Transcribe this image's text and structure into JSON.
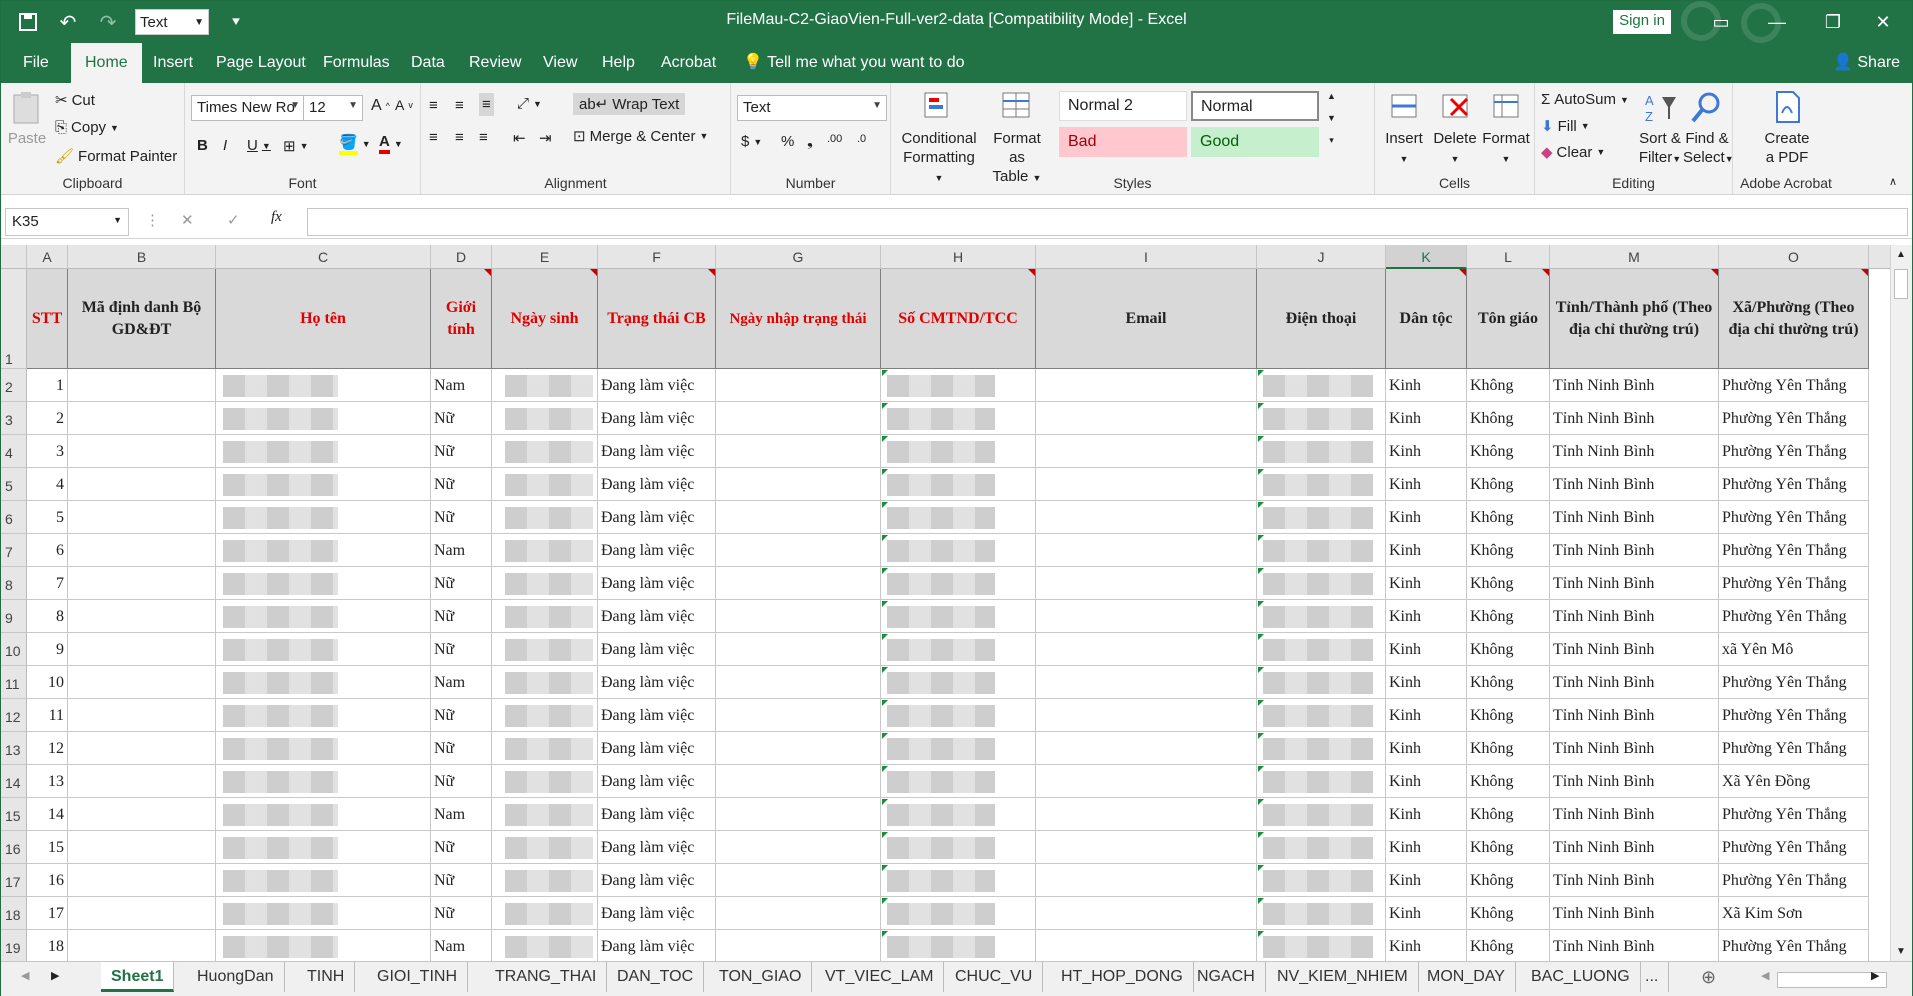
{
  "window": {
    "title": "FileMau-C2-GiaoVien-Full-ver2-data  [Compatibility Mode]  -  Excel",
    "signin": "Sign in",
    "qat_format": "Text"
  },
  "ribbon_tabs": [
    "File",
    "Home",
    "Insert",
    "Page Layout",
    "Formulas",
    "Data",
    "Review",
    "View",
    "Help",
    "Acrobat"
  ],
  "tellme": "Tell me what you want to do",
  "share": "Share",
  "clipboard": {
    "paste": "Paste",
    "cut": "Cut",
    "copy": "Copy",
    "format_painter": "Format Painter",
    "label": "Clipboard"
  },
  "font": {
    "name": "Times New Ro",
    "size": "12",
    "label": "Font"
  },
  "alignment": {
    "wrap": "Wrap Text",
    "merge": "Merge & Center",
    "label": "Alignment"
  },
  "number": {
    "format": "Text",
    "label": "Number"
  },
  "styles": {
    "cond1": "Conditional",
    "cond2": "Formatting",
    "fmt1": "Format as",
    "fmt2": "Table",
    "normal2": "Normal 2",
    "normal": "Normal",
    "bad": "Bad",
    "good": "Good",
    "label": "Styles"
  },
  "cells": {
    "insert": "Insert",
    "delete": "Delete",
    "format": "Format",
    "label": "Cells"
  },
  "editing": {
    "autosum": "AutoSum",
    "fill": "Fill",
    "clear": "Clear",
    "sort1": "Sort &",
    "sort2": "Filter",
    "find1": "Find &",
    "find2": "Select",
    "label": "Editing"
  },
  "acrobat": {
    "create1": "Create",
    "create2": "a PDF",
    "label": "Adobe Acrobat"
  },
  "namebox": "K35",
  "columns": [
    "A",
    "B",
    "C",
    "D",
    "E",
    "F",
    "G",
    "H",
    "I",
    "J",
    "K",
    "L",
    "M",
    "O"
  ],
  "headers": {
    "A": "STT",
    "B": "Mã định danh Bộ GD&ĐT",
    "C": "Họ tên",
    "D": "Giới tính",
    "E": "Ngày sinh",
    "F": "Trạng thái CB",
    "G": "Ngày nhập trạng thái",
    "H": "Số CMTND/TCC",
    "I": "Email",
    "J": "Điện thoại",
    "K": "Dân tộc",
    "L": "Tôn giáo",
    "M": "Tỉnh/Thành phố (Theo địa chỉ thường trú)",
    "O": "Xã/Phường (Theo địa chỉ thường trú)"
  },
  "rows": [
    {
      "stt": "1",
      "gender": "Nam",
      "status": "Đang làm việc",
      "ethnic": "Kinh",
      "religion": "Không",
      "province": "Tỉnh Ninh Bình",
      "commune": "Phường Yên Thắng"
    },
    {
      "stt": "2",
      "gender": "Nữ",
      "status": "Đang làm việc",
      "ethnic": "Kinh",
      "religion": "Không",
      "province": "Tỉnh Ninh Bình",
      "commune": "Phường Yên Thắng"
    },
    {
      "stt": "3",
      "gender": "Nữ",
      "status": "Đang làm việc",
      "ethnic": "Kinh",
      "religion": "Không",
      "province": "Tỉnh Ninh Bình",
      "commune": "Phường Yên Thắng"
    },
    {
      "stt": "4",
      "gender": "Nữ",
      "status": "Đang làm việc",
      "ethnic": "Kinh",
      "religion": "Không",
      "province": "Tỉnh Ninh Bình",
      "commune": "Phường Yên Thắng"
    },
    {
      "stt": "5",
      "gender": "Nữ",
      "status": "Đang làm việc",
      "ethnic": "Kinh",
      "religion": "Không",
      "province": "Tỉnh Ninh Bình",
      "commune": "Phường Yên Thắng"
    },
    {
      "stt": "6",
      "gender": "Nam",
      "status": "Đang làm việc",
      "ethnic": "Kinh",
      "religion": "Không",
      "province": "Tỉnh Ninh Bình",
      "commune": "Phường Yên Thắng"
    },
    {
      "stt": "7",
      "gender": "Nữ",
      "status": "Đang làm việc",
      "ethnic": "Kinh",
      "religion": "Không",
      "province": "Tỉnh Ninh Bình",
      "commune": "Phường Yên Thắng"
    },
    {
      "stt": "8",
      "gender": "Nữ",
      "status": "Đang làm việc",
      "ethnic": "Kinh",
      "religion": "Không",
      "province": "Tỉnh Ninh Bình",
      "commune": "Phường Yên Thắng"
    },
    {
      "stt": "9",
      "gender": "Nữ",
      "status": "Đang làm việc",
      "ethnic": "Kinh",
      "religion": "Không",
      "province": "Tỉnh Ninh Bình",
      "commune": "xã Yên Mô"
    },
    {
      "stt": "10",
      "gender": "Nam",
      "status": "Đang làm việc",
      "ethnic": "Kinh",
      "religion": "Không",
      "province": "Tỉnh Ninh Bình",
      "commune": "Phường Yên Thắng"
    },
    {
      "stt": "11",
      "gender": "Nữ",
      "status": "Đang làm việc",
      "ethnic": "Kinh",
      "religion": "Không",
      "province": "Tỉnh Ninh Bình",
      "commune": "Phường Yên Thắng"
    },
    {
      "stt": "12",
      "gender": "Nữ",
      "status": "Đang làm việc",
      "ethnic": "Kinh",
      "religion": "Không",
      "province": "Tỉnh Ninh Bình",
      "commune": "Phường Yên Thắng"
    },
    {
      "stt": "13",
      "gender": "Nữ",
      "status": "Đang làm việc",
      "ethnic": "Kinh",
      "religion": "Không",
      "province": "Tỉnh Ninh Bình",
      "commune": "Xã Yên Đồng"
    },
    {
      "stt": "14",
      "gender": "Nam",
      "status": "Đang làm việc",
      "ethnic": "Kinh",
      "religion": "Không",
      "province": "Tỉnh Ninh Bình",
      "commune": "Phường Yên Thắng"
    },
    {
      "stt": "15",
      "gender": "Nữ",
      "status": "Đang làm việc",
      "ethnic": "Kinh",
      "religion": "Không",
      "province": "Tỉnh Ninh Bình",
      "commune": "Phường Yên Thắng"
    },
    {
      "stt": "16",
      "gender": "Nữ",
      "status": "Đang làm việc",
      "ethnic": "Kinh",
      "religion": "Không",
      "province": "Tỉnh Ninh Bình",
      "commune": "Phường Yên Thắng"
    },
    {
      "stt": "17",
      "gender": "Nữ",
      "status": "Đang làm việc",
      "ethnic": "Kinh",
      "religion": "Không",
      "province": "Tỉnh Ninh Bình",
      "commune": "Xã Kim Sơn"
    },
    {
      "stt": "18",
      "gender": "Nam",
      "status": "Đang làm việc",
      "ethnic": "Kinh",
      "religion": "Không",
      "province": "Tỉnh Ninh Bình",
      "commune": "Phường Yên Thắng"
    }
  ],
  "row_numbers": [
    "1",
    "2",
    "3",
    "4",
    "5",
    "6",
    "7",
    "8",
    "9",
    "10",
    "11",
    "12",
    "13",
    "14",
    "15",
    "16",
    "17",
    "18",
    "19"
  ],
  "sheets": [
    "Sheet1",
    "HuongDan",
    "TINH",
    "GIOI_TINH",
    "TRANG_THAI",
    "DAN_TOC",
    "TON_GIAO",
    "VT_VIEC_LAM",
    "CHUC_VU",
    "HT_HOP_DONG",
    "NGACH",
    "NV_KIEM_NHIEM",
    "MON_DAY",
    "BAC_LUONG",
    "..."
  ],
  "colors": {
    "excel_green": "#217346",
    "header_red": "#e00000",
    "header_fill": "#d9d9d9"
  }
}
